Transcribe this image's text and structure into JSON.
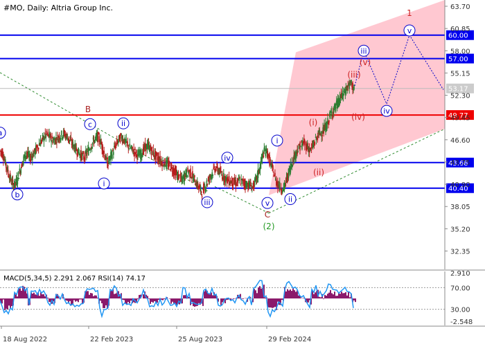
{
  "chart_data": {
    "type": "candlestick",
    "title": "#MO, Daily:  Altria Group Inc.",
    "price_axis": {
      "ticks": [
        "63.70",
        "60.85",
        "58.00",
        "55.15",
        "52.30",
        "49.45",
        "46.60",
        "43.75",
        "40.90",
        "38.05",
        "35.20",
        "32.35"
      ],
      "ylim": [
        30.0,
        64.5
      ]
    },
    "x_ticks": [
      "18 Aug 2022",
      "22 Feb 2023",
      "25 Aug 2023",
      "29 Feb 2024"
    ],
    "levels": [
      {
        "value": 60.0,
        "label": "60.00",
        "color": "#0000ee"
      },
      {
        "value": 57.0,
        "label": "57.00",
        "color": "#0000ee"
      },
      {
        "value": 49.77,
        "label": "49.77",
        "color": "#ee0000"
      },
      {
        "value": 43.68,
        "label": "43.68",
        "color": "#0000ee"
      },
      {
        "value": 40.4,
        "label": "40.40",
        "color": "#0000ee"
      }
    ],
    "current_price": {
      "value": 53.17,
      "label": "53.17"
    },
    "close_series": [
      45.3,
      44.8,
      43.2,
      41.8,
      40.8,
      41.2,
      42.5,
      44.0,
      45.0,
      44.2,
      44.8,
      45.5,
      46.2,
      46.8,
      47.3,
      46.9,
      46.5,
      46.8,
      47.1,
      47.4,
      47.0,
      46.4,
      45.8,
      45.2,
      44.7,
      44.3,
      45.0,
      45.8,
      46.5,
      47.0,
      46.3,
      44.8,
      43.5,
      44.5,
      45.5,
      46.4,
      47.0,
      46.5,
      45.9,
      45.4,
      45.0,
      44.6,
      44.8,
      45.6,
      45.8,
      45.2,
      44.6,
      44.2,
      43.8,
      43.6,
      43.4,
      43.0,
      42.4,
      41.8,
      41.4,
      42.2,
      42.6,
      42.0,
      41.2,
      40.5,
      39.8,
      40.8,
      41.6,
      42.4,
      43.0,
      42.6,
      42.0,
      41.6,
      41.3,
      41.2,
      41.0,
      41.4,
      41.2,
      40.9,
      40.8,
      40.5,
      41.5,
      43.0,
      44.8,
      45.3,
      43.8,
      42.5,
      41.2,
      40.6,
      40.2,
      41.5,
      43.0,
      44.2,
      45.2,
      45.8,
      46.2,
      45.8,
      45.2,
      46.0,
      47.0,
      47.5,
      47.8,
      48.6,
      49.8,
      50.5,
      51.2,
      52.0,
      52.6,
      53.4,
      53.8,
      53.2
    ],
    "wave_labels": [
      {
        "text": "a",
        "color": "#0000cc",
        "circle": true,
        "style": "circle",
        "t": 0,
        "price": 47.5
      },
      {
        "text": "b",
        "color": "#0000cc",
        "circle": true,
        "style": "circle",
        "t": 25,
        "price": 39.6
      },
      {
        "text": "c",
        "color": "#0000cc",
        "circle": true,
        "style": "circle",
        "t": 130,
        "price": 48.6
      },
      {
        "text": "B",
        "color": "#aa2222",
        "circle": false,
        "style": "plain",
        "t": 127,
        "price": 50.5
      },
      {
        "text": "i",
        "color": "#0000cc",
        "circle": true,
        "style": "circle",
        "t": 150,
        "price": 41.0
      },
      {
        "text": "ii",
        "color": "#0000cc",
        "circle": true,
        "style": "circle",
        "t": 178,
        "price": 48.7
      },
      {
        "text": "iii",
        "color": "#0000cc",
        "circle": true,
        "style": "circle",
        "t": 299,
        "price": 38.6
      },
      {
        "text": "iv",
        "color": "#0000cc",
        "circle": true,
        "style": "circle",
        "t": 328,
        "price": 44.3
      },
      {
        "text": "v",
        "color": "#0000cc",
        "circle": true,
        "style": "circle",
        "t": 386,
        "price": 38.5
      },
      {
        "text": "C",
        "color": "#aa2222",
        "circle": false,
        "style": "plain",
        "t": 386,
        "price": 37.0
      },
      {
        "text": "(2)",
        "color": "#229922",
        "circle": false,
        "style": "plain",
        "t": 388,
        "price": 35.5
      },
      {
        "text": "i",
        "color": "#0000cc",
        "circle": true,
        "style": "circle",
        "t": 400,
        "price": 46.5
      },
      {
        "text": "ii",
        "color": "#0000cc",
        "circle": true,
        "style": "circle",
        "t": 419,
        "price": 39.0
      },
      {
        "text": "(i)",
        "color": "#cc2222",
        "circle": false,
        "style": "plain",
        "t": 452,
        "price": 48.8
      },
      {
        "text": "(ii)",
        "color": "#cc2222",
        "circle": false,
        "style": "plain",
        "t": 460,
        "price": 42.4
      },
      {
        "text": "(iii)",
        "color": "#cc2222",
        "circle": false,
        "style": "plain",
        "t": 511,
        "price": 54.9
      },
      {
        "text": "(iv)",
        "color": "#cc2222",
        "circle": false,
        "style": "plain",
        "t": 517,
        "price": 49.5
      },
      {
        "text": "(v)",
        "color": "#cc2222",
        "circle": false,
        "style": "plain",
        "t": 527,
        "price": 56.5
      },
      {
        "text": "iii",
        "color": "#0000cc",
        "circle": true,
        "style": "circle",
        "t": 525,
        "price": 58.0
      },
      {
        "text": "iv",
        "color": "#0000cc",
        "circle": true,
        "style": "circle",
        "t": 558,
        "price": 50.3
      },
      {
        "text": "v",
        "color": "#0000cc",
        "circle": true,
        "style": "circle",
        "t": 591,
        "price": 60.6
      },
      {
        "text": "1",
        "color": "#cc2222",
        "circle": false,
        "style": "plain",
        "t": 591,
        "price": 62.8
      }
    ],
    "projection_path": [
      {
        "t": 512,
        "price": 53.5
      },
      {
        "t": 525,
        "price": 58.0
      },
      {
        "t": 558,
        "price": 51.2
      },
      {
        "t": 591,
        "price": 60.0
      },
      {
        "t": 640,
        "price": 53.0
      }
    ],
    "oscillator": {
      "label": "MACD(5,34,5) 2.291 2.067 RSI(14) 74.17",
      "ticks": [
        "2.910",
        "70.00",
        "30.00",
        "-2.548"
      ],
      "rsi_levels": [
        70,
        30
      ]
    },
    "colors": {
      "up": "#2e7d32",
      "down": "#b71c1c",
      "channel": "#ffb6c1",
      "histogram": "#8b1a6b",
      "rsi": "#2196f3"
    }
  }
}
